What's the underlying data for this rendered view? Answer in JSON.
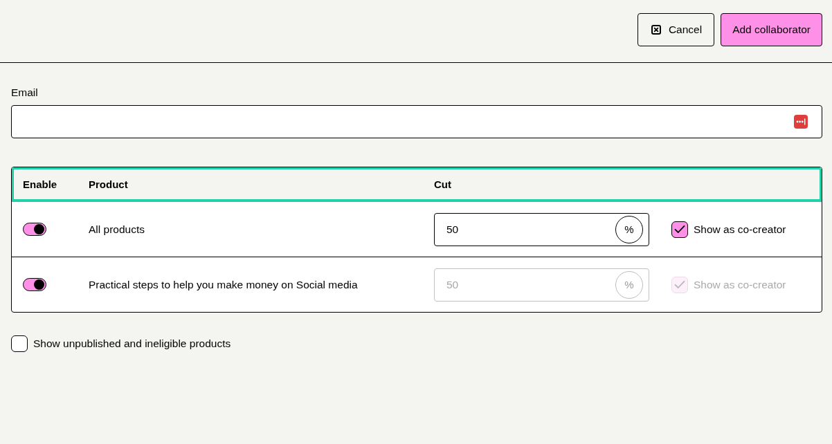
{
  "header": {
    "buttons": [
      {
        "kind": "cancel",
        "label": "Cancel"
      },
      {
        "kind": "primary",
        "label": "Add collaborator"
      }
    ]
  },
  "email": {
    "label": "Email"
  },
  "table": {
    "header_focused": true,
    "columns": [
      "Enable",
      "Product",
      "Cut"
    ],
    "rows": [
      {
        "enabled": true,
        "product": "All products",
        "cut": "50",
        "cut_unit": "%",
        "cut_disabled": false,
        "co_creator": {
          "label": "Show as co-creator",
          "checked": true,
          "disabled": false
        }
      },
      {
        "enabled": true,
        "product": "Practical steps to help you make money on Social media",
        "cut": "50",
        "cut_unit": "%",
        "cut_disabled": true,
        "co_creator": {
          "label": "Show as co-creator",
          "checked": true,
          "disabled": true
        }
      }
    ]
  },
  "show_unpublished": {
    "label": "Show unpublished and ineligible products",
    "checked": false
  }
}
